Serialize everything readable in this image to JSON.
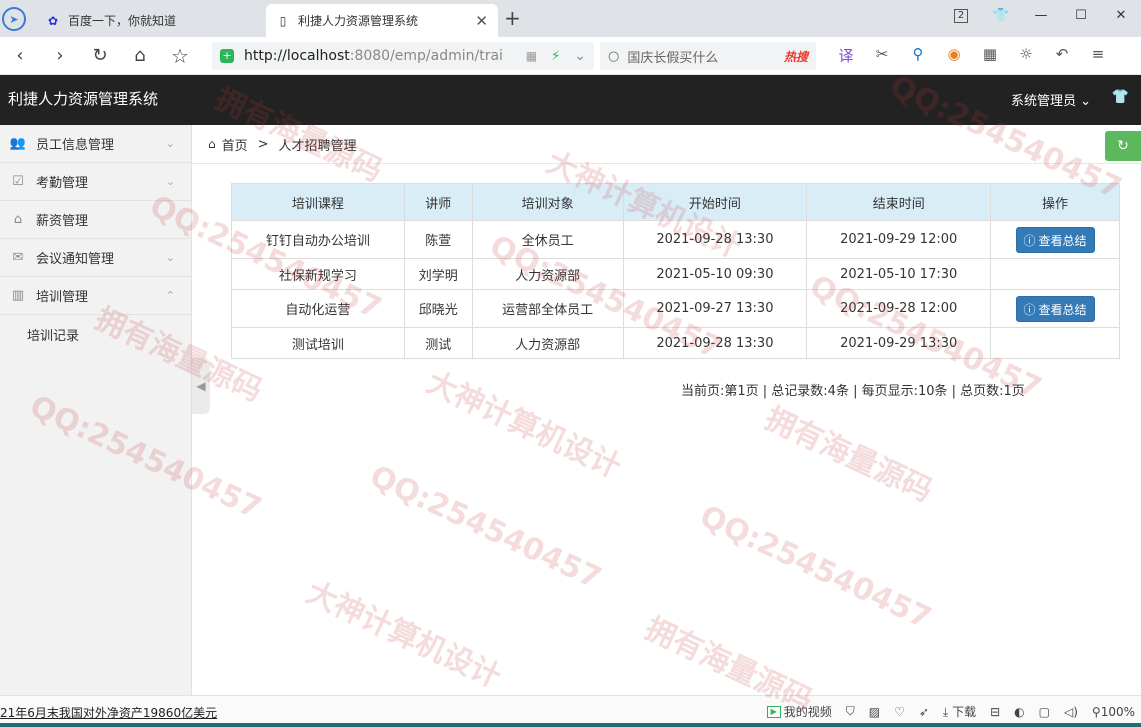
{
  "browser": {
    "tabs": [
      {
        "title": "百度一下，你就知道",
        "favicon": "baidu-paw-icon"
      },
      {
        "title": "利捷人力资源管理系统",
        "favicon": "page-icon"
      }
    ],
    "window_badge": "2",
    "url_host": "http://localhost",
    "url_rest": ":8080/emp/admin/trai",
    "search_placeholder": "国庆长假买什么",
    "search_hot": "热搜"
  },
  "app": {
    "title": "利捷人力资源管理系统",
    "user_menu": "系统管理员"
  },
  "sidebar": {
    "items": [
      {
        "label": "员工信息管理",
        "icon": "users-icon"
      },
      {
        "label": "考勤管理",
        "icon": "clipboard-check-icon"
      },
      {
        "label": "薪资管理",
        "icon": "bank-icon"
      },
      {
        "label": "会议通知管理",
        "icon": "envelope-icon"
      },
      {
        "label": "培训管理",
        "icon": "book-icon"
      }
    ],
    "sub_item": "培训记录"
  },
  "breadcrumb": {
    "home": "首页",
    "separator": ">",
    "current": "人才招聘管理"
  },
  "table": {
    "headers": [
      "培训课程",
      "讲师",
      "培训对象",
      "开始时间",
      "结束时间",
      "操作"
    ],
    "rows": [
      {
        "course": "钉钉自动办公培训",
        "teacher": "陈萱",
        "target": "全休员工",
        "start": "2021-09-28 13:30",
        "end": "2021-09-29 12:00",
        "action": "查看总结"
      },
      {
        "course": "社保新规学习",
        "teacher": "刘学明",
        "target": "人力资源部",
        "start": "2021-05-10 09:30",
        "end": "2021-05-10 17:30",
        "action": ""
      },
      {
        "course": "自动化运营",
        "teacher": "邱晓光",
        "target": "运营部全体员工",
        "start": "2021-09-27 13:30",
        "end": "2021-09-28 12:00",
        "action": "查看总结"
      },
      {
        "course": "测试培训",
        "teacher": "测试",
        "target": "人力资源部",
        "start": "2021-09-28 13:30",
        "end": "2021-09-29 13:30",
        "action": ""
      }
    ]
  },
  "pager": "当前页:第1页 | 总记录数:4条 | 每页显示:10条 | 总页数:1页",
  "statusbar": {
    "news": "21年6月末我国对外净资产19860亿美元",
    "video": "我的视频",
    "download": "下载",
    "zoom": "100%"
  },
  "watermarks": [
    "QQ:254540457",
    "大神计算机设计",
    "拥有海量源码"
  ],
  "colors": {
    "header_bg": "#222222",
    "table_head_bg": "#d9edf7",
    "primary_button": "#337ab7",
    "refresh_button": "#5cb85c"
  }
}
